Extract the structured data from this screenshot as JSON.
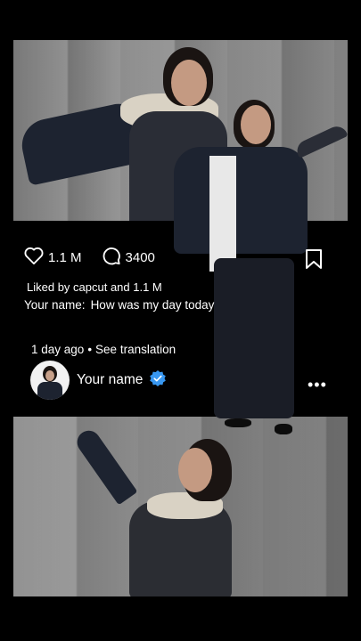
{
  "post": {
    "likes": "1.1 M",
    "comments": "3400",
    "liked_by": "Liked by capcut and 1.1 M",
    "caption_user": "Your name:",
    "caption_text": "How was my day today",
    "time": "1 day ago",
    "separator": "•",
    "translation": "See translation",
    "username": "Your name",
    "more": "•••"
  },
  "icons": {
    "like": "heart-icon",
    "comment": "comment-bubble-icon",
    "save": "bookmark-icon",
    "verified": "verified-badge-icon",
    "more": "more-dots-icon"
  },
  "colors": {
    "verified": "#3897f0",
    "background": "#000000"
  }
}
